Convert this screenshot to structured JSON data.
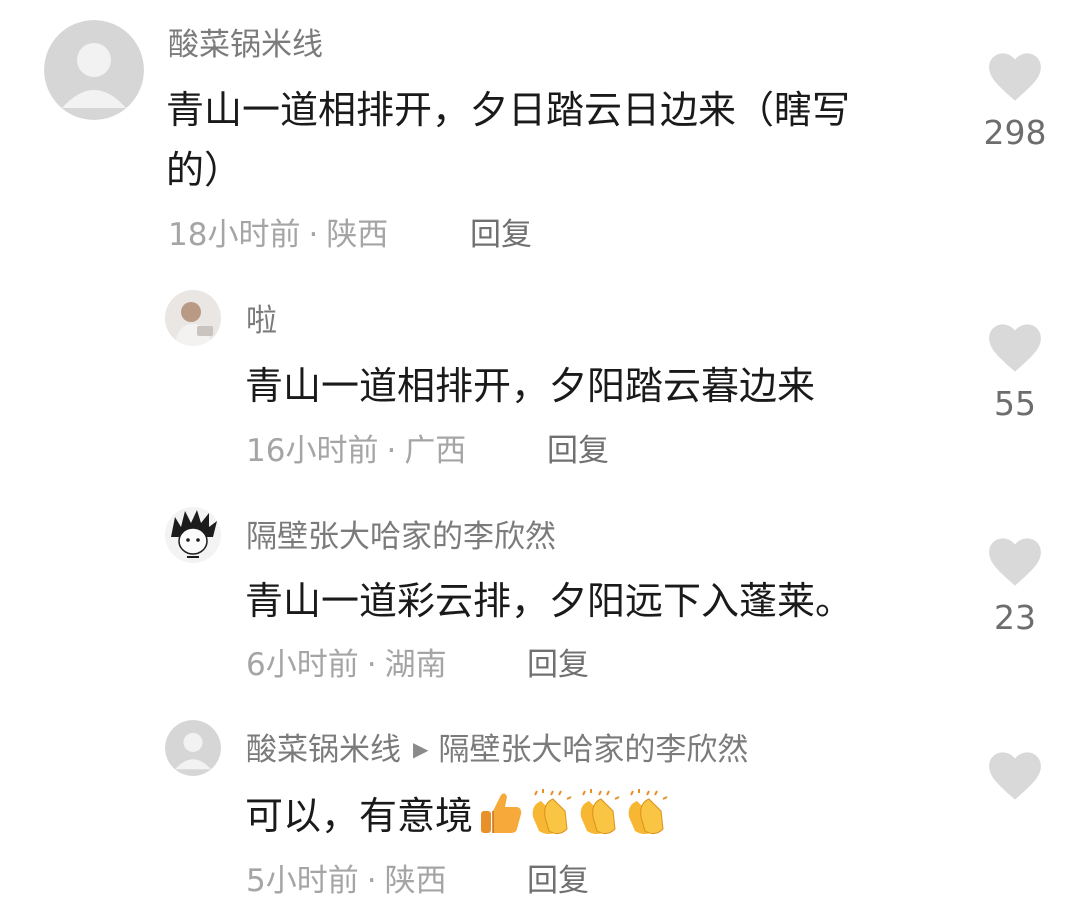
{
  "comments": [
    {
      "username": "酸菜锅米线",
      "text_lines": [
        "青山一道相排开，夕日踏云日边来（瞎写",
        "的）"
      ],
      "time": "18小时前",
      "location": "陕西",
      "reply_label": "回复",
      "like_count": "298",
      "avatar_icon": "default-user-avatar-icon"
    },
    {
      "username": "啦",
      "text_lines": [
        "青山一道相排开，夕阳踏云暮边来"
      ],
      "time": "16小时前",
      "location": "广西",
      "reply_label": "回复",
      "like_count": "55",
      "avatar_icon": "photo-avatar-icon"
    },
    {
      "username": "隔壁张大哈家的李欣然",
      "text_lines": [
        "青山一道彩云排，夕阳远下入蓬莱。"
      ],
      "time": "6小时前",
      "location": "湖南",
      "reply_label": "回复",
      "like_count": "23",
      "avatar_icon": "anime-character-avatar-icon"
    },
    {
      "username": "酸菜锅米线",
      "reply_to": "隔壁张大哈家的李欣然",
      "text_lines": [
        "可以，有意境"
      ],
      "emojis": [
        "thumbs-up-emoji",
        "clapping-hands-emoji",
        "clapping-hands-emoji",
        "clapping-hands-emoji"
      ],
      "time": "5小时前",
      "location": "陕西",
      "reply_label": "回复",
      "like_count": "",
      "avatar_icon": "default-user-avatar-icon"
    }
  ],
  "meta_separator": "·",
  "colors": {
    "heart": "#d9d9d9",
    "username": "#7b7b7b",
    "body_text": "#1a1a1a",
    "meta_text": "#a5a5a5"
  }
}
